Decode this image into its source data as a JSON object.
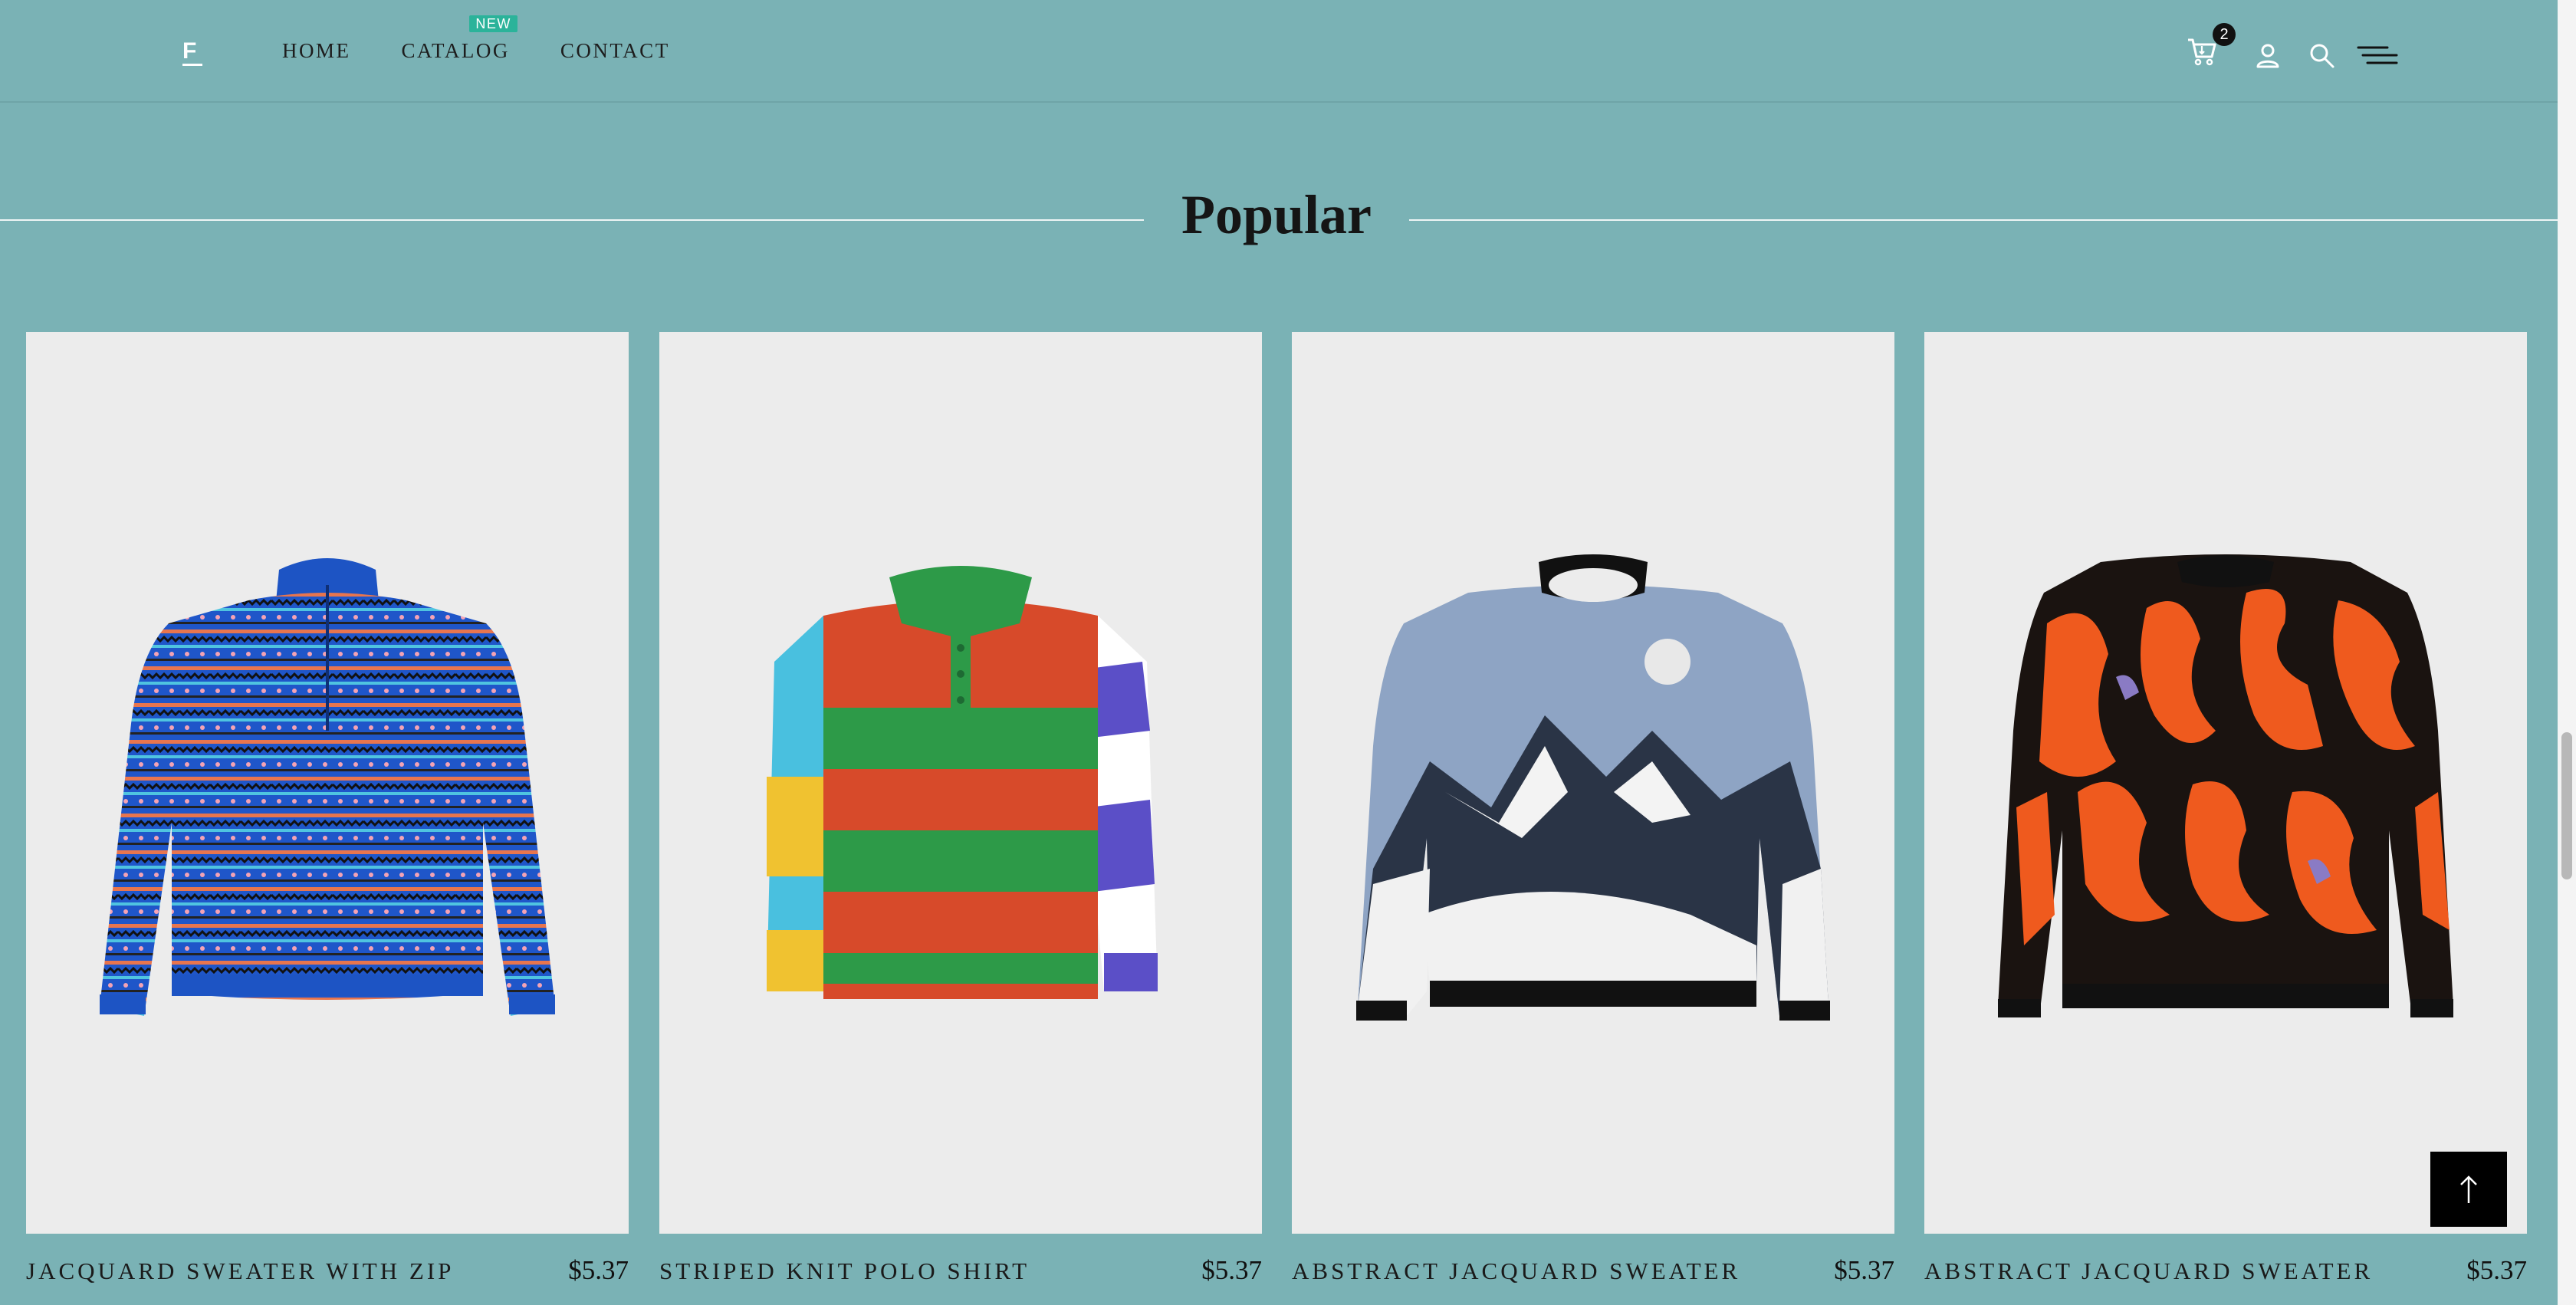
{
  "header": {
    "logo_letter": "F",
    "nav": [
      {
        "label": "HOME"
      },
      {
        "label": "CATALOG",
        "badge": "NEW"
      },
      {
        "label": "CONTACT"
      }
    ],
    "cart_count": "2",
    "icons": [
      "cart-icon",
      "user-icon",
      "search-icon",
      "menu-icon"
    ]
  },
  "section": {
    "title": "Popular"
  },
  "products": [
    {
      "name": "JACQUARD SWEATER WITH ZIP",
      "price": "$5.37",
      "image": "blue fair isle zip sweater"
    },
    {
      "name": "STRIPED KNIT POLO SHIRT",
      "price": "$5.37",
      "image": "red green striped polo"
    },
    {
      "name": "ABSTRACT JACQUARD SWEATER",
      "price": "$5.37",
      "image": "mountain landscape sweater"
    },
    {
      "name": "ABSTRACT JACQUARD SWEATER",
      "price": "$5.37",
      "image": "orange black abstract sweater"
    }
  ],
  "colors": {
    "page_bg": "#7ab2b5",
    "badge": "#2bb39a",
    "card_bg": "#ececec"
  }
}
